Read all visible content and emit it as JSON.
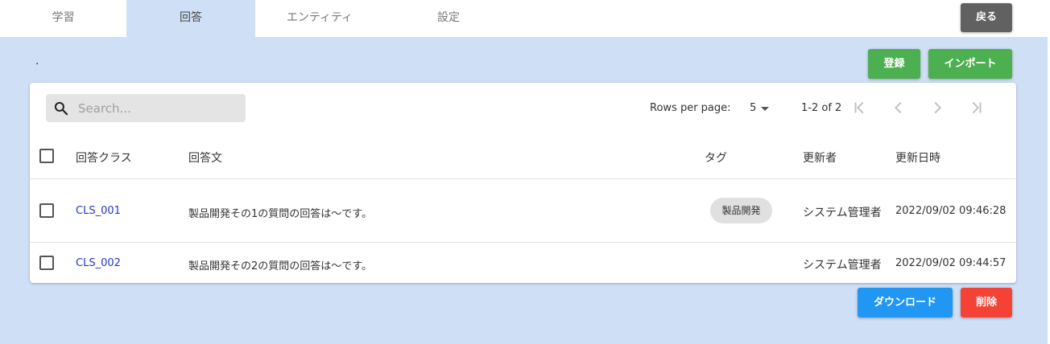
{
  "tabs": [
    {
      "label": "学習"
    },
    {
      "label": "回答"
    },
    {
      "label": "エンティティ"
    },
    {
      "label": "設定"
    }
  ],
  "buttons": {
    "back": "戻る",
    "register": "登録",
    "import": "インポート",
    "download": "ダウンロード",
    "delete": "削除"
  },
  "subtitle": ".",
  "search": {
    "placeholder": "Search...",
    "value": ""
  },
  "pagination": {
    "rows_per_page_label": "Rows per page:",
    "rows_per_page_value": "5",
    "range": "1-2 of 2"
  },
  "table": {
    "headers": [
      "回答クラス",
      "回答文",
      "タグ",
      "更新者",
      "更新日時"
    ],
    "rows": [
      {
        "cls": "CLS_001",
        "text": "製品開発その1の質問の回答は～です。",
        "tag": "製品開発",
        "user": "システム管理者",
        "date": "2022/09/02 09:46:28"
      },
      {
        "cls": "CLS_002",
        "text": "製品開発その2の質問の回答は～です。",
        "tag": "",
        "user": "システム管理者",
        "date": "2022/09/02 09:44:57"
      }
    ]
  },
  "colors": {
    "background": "#cfdff5",
    "green": "#4caf50",
    "blue": "#2196f3",
    "red": "#f44336",
    "gray": "#616161",
    "link": "#2a35c8"
  },
  "icons": [
    "search-icon",
    "first-page-icon",
    "prev-page-icon",
    "next-page-icon",
    "last-page-icon",
    "caret-down-icon"
  ]
}
